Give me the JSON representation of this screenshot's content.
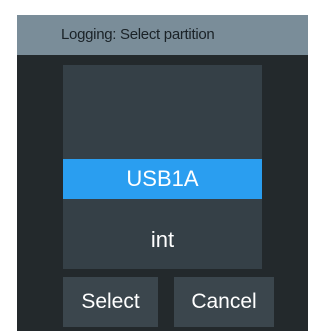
{
  "dialog": {
    "title": "Logging:  Select partition"
  },
  "partitions": {
    "items": [
      {
        "label": "USB1A",
        "selected": true
      },
      {
        "label": "int",
        "selected": false
      }
    ]
  },
  "buttons": {
    "select_label": "Select",
    "cancel_label": "Cancel"
  },
  "colors": {
    "selected_item": "#2a9ef0",
    "dialog_bg": "#23292c",
    "titlebar_bg": "#7a8d99",
    "list_bg": "#354047",
    "button_bg": "#3b464d"
  }
}
